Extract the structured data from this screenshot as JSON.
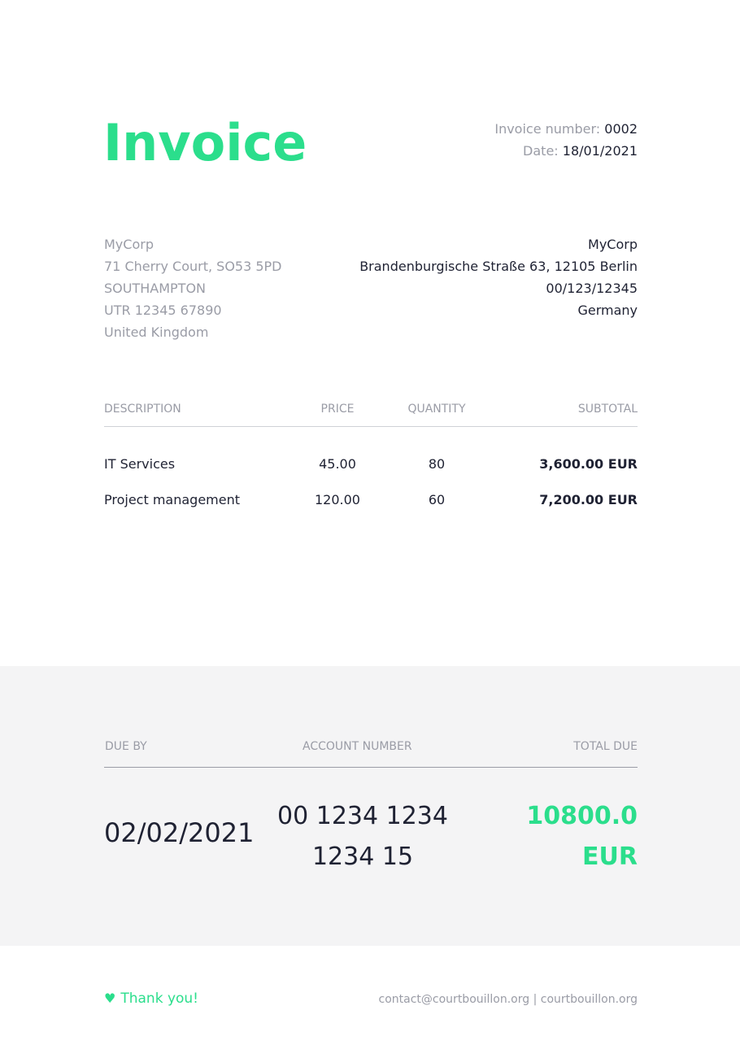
{
  "header": {
    "title": "Invoice",
    "invoice_number_label": "Invoice number:",
    "invoice_number": "0002",
    "date_label": "Date:",
    "date": "18/01/2021"
  },
  "from": {
    "lines": [
      "MyCorp",
      "71 Cherry Court, SO53 5PD",
      "SOUTHAMPTON",
      "UTR 12345 67890",
      "United Kingdom"
    ]
  },
  "to": {
    "lines": [
      "MyCorp",
      "Brandenburgische Straße 63, 12105 Berlin",
      "00/123/12345",
      "Germany"
    ]
  },
  "items_table": {
    "headers": {
      "description": "DESCRIPTION",
      "price": "PRICE",
      "quantity": "QUANTITY",
      "subtotal": "SUBTOTAL"
    },
    "rows": [
      {
        "description": "IT Services",
        "price": "45.00",
        "quantity": "80",
        "subtotal": "3,600.00 EUR"
      },
      {
        "description": "Project management",
        "price": "120.00",
        "quantity": "60",
        "subtotal": "7,200.00 EUR"
      }
    ]
  },
  "summary": {
    "due_by_label": "DUE BY",
    "account_number_label": "ACCOUNT NUMBER",
    "total_due_label": "TOTAL DUE",
    "due_by": "02/02/2021",
    "account_number": "00 1234 1234 1234 15",
    "total_due": "10800.0 EUR"
  },
  "footer": {
    "heart_icon": "heart-icon",
    "thanks": "Thank you!",
    "contact": "contact@courtbouillon.org | courtbouillon.org"
  },
  "colors": {
    "accent": "#2bde8c",
    "text": "#1f2233",
    "muted": "#9a9ca6",
    "summary_background": "#f4f4f5"
  }
}
